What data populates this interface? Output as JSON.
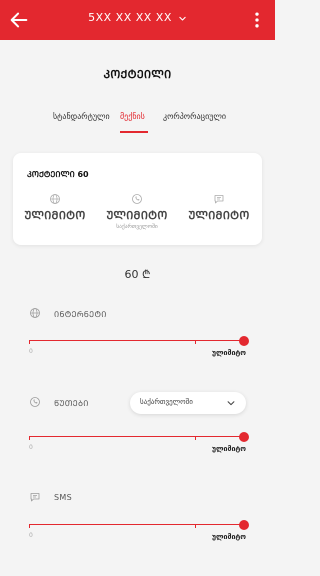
{
  "header": {
    "phone": "5XX XX XX XX",
    "back_icon": "arrow-left-icon",
    "menu_icon": "more-vertical-icon",
    "dropdown_icon": "chevron-down-icon"
  },
  "page": {
    "title": "ᲙᲝᲥᲢᲔᲘᲚᲘ"
  },
  "tabs": [
    {
      "label": "სტანდარტული"
    },
    {
      "label": "მექნის"
    },
    {
      "label": "კორპორაციული"
    }
  ],
  "card": {
    "title": "ᲙᲝᲥᲢᲔᲘᲚᲘ 60",
    "features": [
      {
        "icon": "globe-icon",
        "value": "ᲣᲚᲘᲛᲘᲢᲝ",
        "sub": ""
      },
      {
        "icon": "phone-icon",
        "value": "ᲣᲚᲘᲛᲘᲢᲝ",
        "sub": "საქართველოში"
      },
      {
        "icon": "sms-icon",
        "value": "ᲣᲚᲘᲛᲘᲢᲝ",
        "sub": ""
      }
    ]
  },
  "price": "60 ₾",
  "sections": {
    "internet": {
      "label": "ᲘᲜᲢᲔᲠᲜᲔᲢᲘ",
      "icon": "globe-icon",
      "zero": "0",
      "value": "ულიმიტო",
      "level": 1.0
    },
    "minutes": {
      "label": "ᲬᲣᲗᲔᲑᲘ",
      "icon": "phone-icon",
      "zero": "0",
      "value": "ულიმიტო",
      "level": 1.0,
      "dropdown": "საქართველოში"
    },
    "sms": {
      "label": "SMS",
      "icon": "sms-icon",
      "zero": "0",
      "value": "ულიმიტო",
      "level": 1.0
    }
  },
  "colors": {
    "accent": "#e3282f",
    "background": "#f4f4f4"
  }
}
